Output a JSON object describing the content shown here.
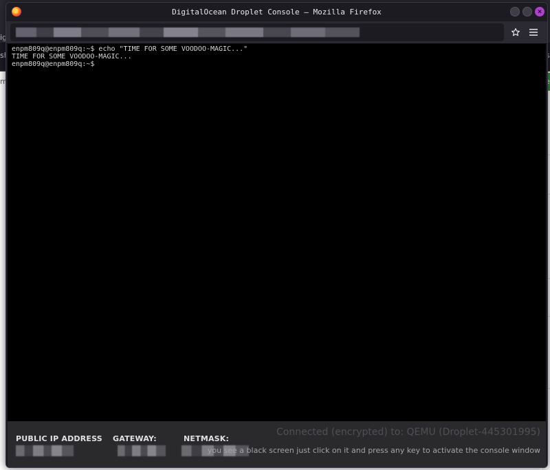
{
  "window": {
    "title": "DigitalOcean Droplet Console — Mozilla Firefox",
    "close_glyph": "×"
  },
  "toolbar": {
    "bookmark_icon": "star-icon",
    "menu_icon": "hamburger-menu-icon"
  },
  "background": {
    "left_fragments": [
      "ig",
      "sh",
      "m"
    ],
    "right_fragments": [
      "s",
      "e"
    ]
  },
  "console": {
    "lines": [
      "enpm809q@enpm809q:~$ echo \"TIME FOR SOME VOODOO-MAGIC...\"",
      "TIME FOR SOME VOODOO-MAGIC...",
      "enpm809q@enpm809q:~$"
    ]
  },
  "footer": {
    "public_ip_label": "PUBLIC IP ADDRESS",
    "gateway_label": "GATEWAY:",
    "netmask_label": "NETMASK:",
    "connection_status": "Connected (encrypted) to: QEMU (Droplet-445301995)",
    "hint": "you see a black screen just click on it and press any key to activate the console window"
  },
  "colors": {
    "console_bg": "#000000",
    "console_text": "#d8d8d8",
    "close_button": "#b13fcf",
    "footer_bg": "#2a2a2d"
  }
}
